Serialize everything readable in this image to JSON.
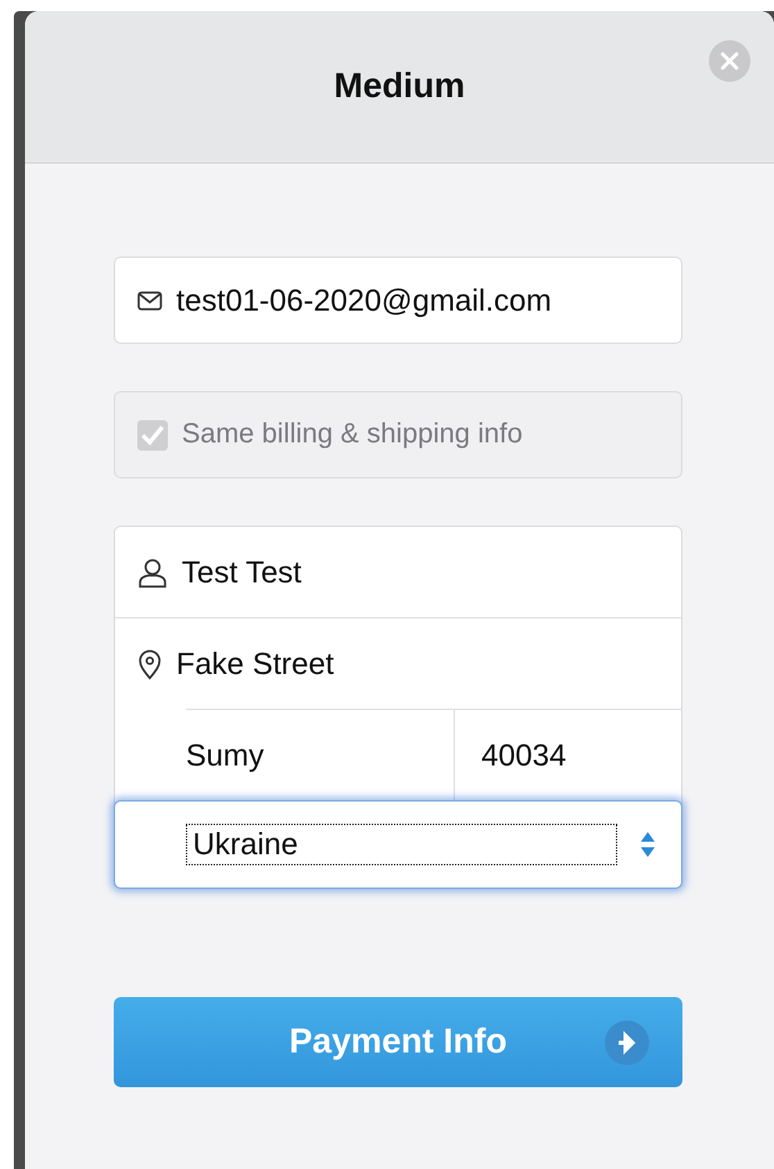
{
  "dialog": {
    "title": "Medium"
  },
  "email": {
    "value": "test01-06-2020@gmail.com"
  },
  "same_info": {
    "label": "Same billing & shipping info",
    "checked": true,
    "disabled": true
  },
  "address": {
    "name": "Test Test",
    "street": "Fake Street",
    "city": "Sumy",
    "zip": "40034",
    "country": {
      "value": "Ukraine",
      "focused": true
    }
  },
  "submit": {
    "label": "Payment Info"
  }
}
